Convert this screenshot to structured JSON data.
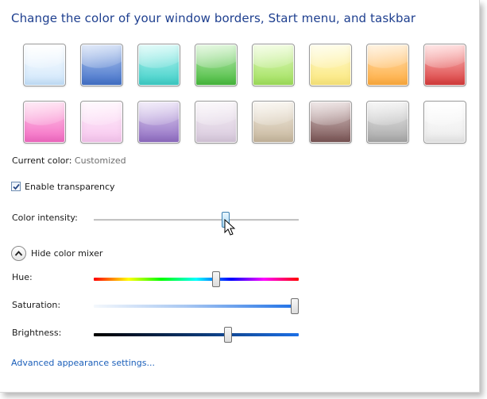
{
  "header": {
    "title": "Change the color of your window borders, Start menu, and taskbar"
  },
  "swatches": [
    {
      "name": "sky",
      "top": "#ffffff",
      "bottom": "#cfe6fb",
      "rim": "#8fb7dc"
    },
    {
      "name": "twilight",
      "top": "#b9cdf0",
      "bottom": "#4170c9",
      "rim": "#3b62a8"
    },
    {
      "name": "sea",
      "top": "#bff6f2",
      "bottom": "#3ccfc8",
      "rim": "#37aaa5"
    },
    {
      "name": "leaf",
      "top": "#c6efbd",
      "bottom": "#47bb3c",
      "rim": "#3e9b35"
    },
    {
      "name": "lime",
      "top": "#e7fbc9",
      "bottom": "#9fe05a",
      "rim": "#86bd4d"
    },
    {
      "name": "lemon",
      "top": "#fffbd6",
      "bottom": "#fbe77a",
      "rim": "#d8c568"
    },
    {
      "name": "pumpkin",
      "top": "#ffe4bd",
      "bottom": "#ffac3d",
      "rim": "#d98f36"
    },
    {
      "name": "ruby",
      "top": "#ffc7c7",
      "bottom": "#d93c3c",
      "rim": "#b13434"
    },
    {
      "name": "fuchsia",
      "top": "#ffd0ea",
      "bottom": "#f46ac3",
      "rim": "#cd5aa5"
    },
    {
      "name": "blush",
      "top": "#fff0fb",
      "bottom": "#f7c6ee",
      "rim": "#d6a8ce"
    },
    {
      "name": "violet",
      "top": "#e2d6f2",
      "bottom": "#8f6cc2",
      "rim": "#7b5ca6"
    },
    {
      "name": "lavender",
      "top": "#f6f0f6",
      "bottom": "#d8c9dd",
      "rim": "#b4a7b8"
    },
    {
      "name": "taupe",
      "top": "#f4eee4",
      "bottom": "#c7b79d",
      "rim": "#a89a84"
    },
    {
      "name": "chocolate",
      "top": "#dccaca",
      "bottom": "#7a5555",
      "rim": "#654848"
    },
    {
      "name": "slate",
      "top": "#ececec",
      "bottom": "#a8a8a8",
      "rim": "#8a8a8a"
    },
    {
      "name": "frost",
      "top": "#ffffff",
      "bottom": "#ececec",
      "rim": "#bdbdbd"
    }
  ],
  "current_color": {
    "label": "Current color:",
    "value": "Customized"
  },
  "transparency": {
    "label": "Enable transparency",
    "checked": true
  },
  "intensity": {
    "label": "Color intensity:",
    "level_percent": 65
  },
  "mixer": {
    "toggle_label": "Hide color mixer",
    "hue_label": "Hue:",
    "hue_percent": 60,
    "saturation_label": "Saturation:",
    "saturation_percent": 100,
    "brightness_label": "Brightness:",
    "brightness_percent": 66
  },
  "footer": {
    "link_label": "Advanced appearance settings..."
  },
  "colors": {
    "title": "#1e3f8f",
    "link": "#1b5fba",
    "accent": "#3c7fb1"
  }
}
